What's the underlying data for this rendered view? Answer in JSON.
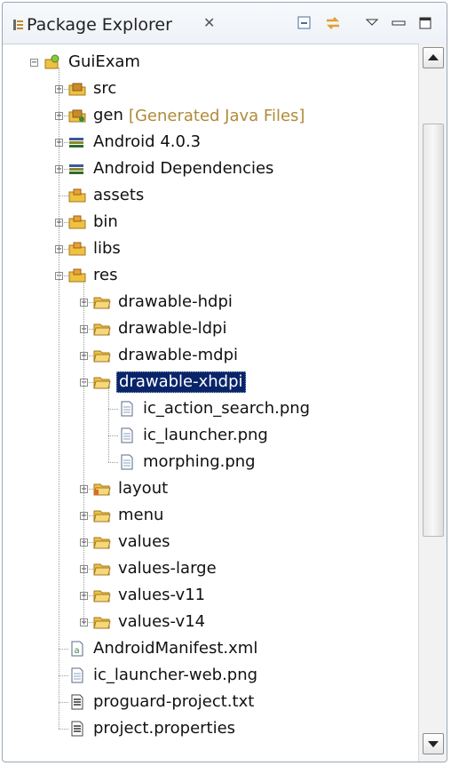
{
  "view": {
    "title": "Package Explorer",
    "close_glyph": "✕",
    "icon": "package-explorer-icon",
    "toolbar": [
      "collapse-all-icon",
      "link-with-editor-icon",
      "view-menu-icon",
      "minimize-icon",
      "maximize-icon"
    ]
  },
  "tree": [
    {
      "label": "GuiExam",
      "icon": "android-project-icon",
      "level": 0,
      "expander": "minus"
    },
    {
      "label": "src",
      "icon": "source-folder-icon",
      "level": 1,
      "expander": "plus"
    },
    {
      "label": "gen",
      "decoration": "[Generated Java Files]",
      "icon": "generated-source-folder-icon",
      "level": 1,
      "expander": "plus"
    },
    {
      "label": "Android 4.0.3",
      "icon": "library-icon",
      "level": 1,
      "expander": "plus"
    },
    {
      "label": "Android Dependencies",
      "icon": "library-icon",
      "level": 1,
      "expander": "plus"
    },
    {
      "label": "assets",
      "icon": "package-folder-icon",
      "level": 1,
      "expander": "none"
    },
    {
      "label": "bin",
      "icon": "package-folder-icon",
      "level": 1,
      "expander": "plus"
    },
    {
      "label": "libs",
      "icon": "package-folder-icon",
      "level": 1,
      "expander": "plus"
    },
    {
      "label": "res",
      "icon": "package-folder-icon",
      "level": 1,
      "expander": "minus"
    },
    {
      "label": "drawable-hdpi",
      "icon": "folder-icon",
      "level": 2,
      "expander": "plus"
    },
    {
      "label": "drawable-ldpi",
      "icon": "folder-icon",
      "level": 2,
      "expander": "plus"
    },
    {
      "label": "drawable-mdpi",
      "icon": "folder-icon",
      "level": 2,
      "expander": "plus"
    },
    {
      "label": "drawable-xhdpi",
      "icon": "folder-icon",
      "level": 2,
      "expander": "minus",
      "selected": true
    },
    {
      "label": "ic_action_search.png",
      "icon": "file-icon",
      "level": 3,
      "expander": "none"
    },
    {
      "label": "ic_launcher.png",
      "icon": "file-icon",
      "level": 3,
      "expander": "none"
    },
    {
      "label": "morphing.png",
      "icon": "file-icon",
      "level": 3,
      "expander": "none"
    },
    {
      "label": "layout",
      "icon": "layout-folder-icon",
      "level": 2,
      "expander": "plus"
    },
    {
      "label": "menu",
      "icon": "folder-icon",
      "level": 2,
      "expander": "plus"
    },
    {
      "label": "values",
      "icon": "folder-icon",
      "level": 2,
      "expander": "plus"
    },
    {
      "label": "values-large",
      "icon": "folder-icon",
      "level": 2,
      "expander": "plus"
    },
    {
      "label": "values-v11",
      "icon": "folder-icon",
      "level": 2,
      "expander": "plus"
    },
    {
      "label": "values-v14",
      "icon": "folder-icon",
      "level": 2,
      "expander": "plus"
    },
    {
      "label": "AndroidManifest.xml",
      "icon": "manifest-file-icon",
      "level": 1,
      "expander": "none"
    },
    {
      "label": "ic_launcher-web.png",
      "icon": "file-icon",
      "level": 1,
      "expander": "none"
    },
    {
      "label": "proguard-project.txt",
      "icon": "text-file-icon",
      "level": 1,
      "expander": "none"
    },
    {
      "label": "project.properties",
      "icon": "text-file-icon",
      "level": 1,
      "expander": "none"
    }
  ],
  "scrollbar": {
    "up_icon": "scroll-up-icon",
    "down_icon": "scroll-down-icon"
  },
  "colors": {
    "selection": "#0a246a",
    "decoration": "#b08a3a",
    "folder": "#f0c040",
    "border": "#9aa7b5"
  }
}
